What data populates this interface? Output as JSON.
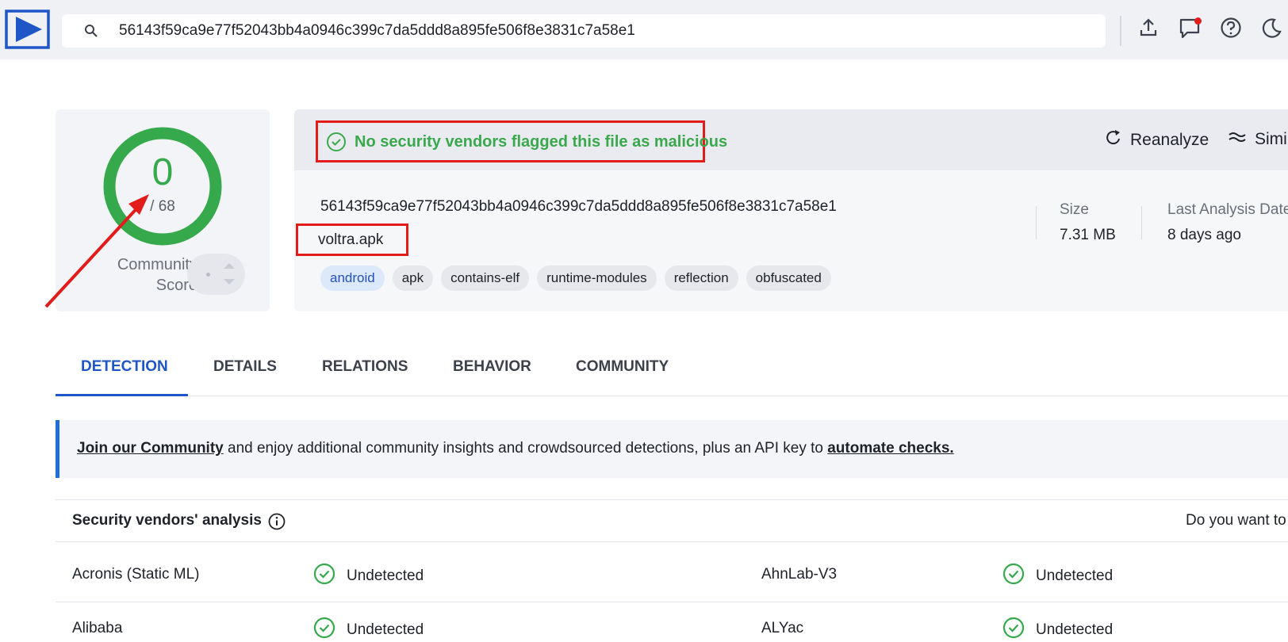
{
  "topbar": {
    "search_value": "56143f59ca9e77f52043bb4a0946c399c7da5ddd8a895fe506f8e3831c7a58e1",
    "icons": [
      "logo-icon",
      "search-icon",
      "upload-icon",
      "notifications-icon",
      "help-icon",
      "dark-mode-icon"
    ],
    "notification_dot_color": "#e11d1d"
  },
  "score": {
    "value": "0",
    "total": "/ 68",
    "community_label_1": "Community",
    "community_label_2": "Score",
    "ring_color": "#35a94b"
  },
  "verdict": {
    "text": "No security vendors flagged this file as malicious",
    "color": "#3aa84c"
  },
  "actions": {
    "reanalyze": "Reanalyze",
    "similar": "Simil"
  },
  "file": {
    "hash": "56143f59ca9e77f52043bb4a0946c399c7da5ddd8a895fe506f8e3831c7a58e1",
    "name": "voltra.apk",
    "tags": [
      "android",
      "apk",
      "contains-elf",
      "runtime-modules",
      "reflection",
      "obfuscated"
    ],
    "size_label": "Size",
    "size_value": "7.31 MB",
    "last_analysis_label": "Last Analysis Date",
    "last_analysis_value": "8 days ago"
  },
  "tabs": [
    "DETECTION",
    "DETAILS",
    "RELATIONS",
    "BEHAVIOR",
    "COMMUNITY"
  ],
  "banner": {
    "link1": "Join our Community",
    "middle": " and enjoy additional community insights and crowdsourced detections, plus an API key to ",
    "link2": "automate checks."
  },
  "vendors": {
    "title": "Security vendors' analysis",
    "cta": "Do you want to",
    "rows": [
      {
        "left_name": "Acronis (Static ML)",
        "left_status": "Undetected",
        "right_name": "AhnLab-V3",
        "right_status": "Undetected"
      },
      {
        "left_name": "Alibaba",
        "left_status": "Undetected",
        "right_name": "ALYac",
        "right_status": "Undetected"
      }
    ]
  },
  "colors": {
    "accent": "#1e56c8",
    "annotation_red": "#e21b1b",
    "success_green": "#35a94b"
  }
}
